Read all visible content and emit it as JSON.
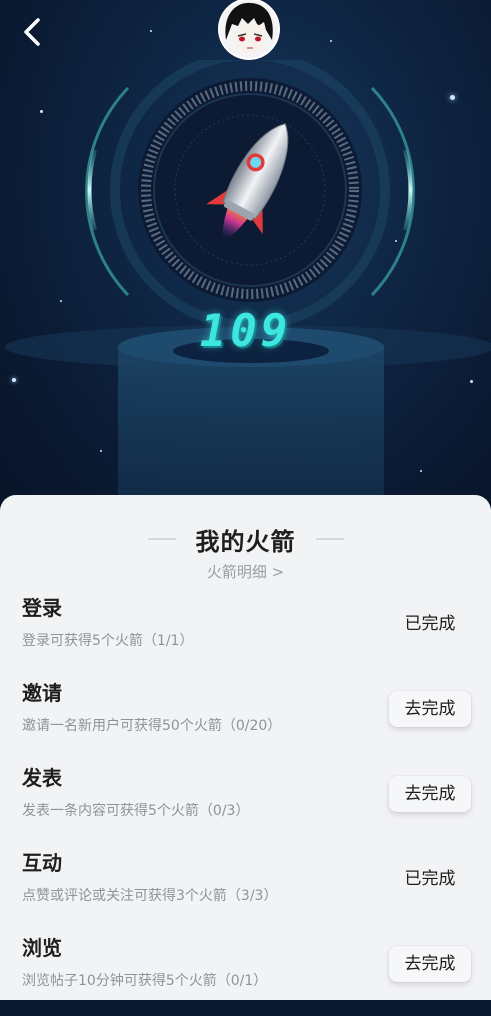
{
  "header": {
    "back_icon": "chevron-left-icon",
    "avatar_icon": "anime-avatar"
  },
  "rocket": {
    "count": "109",
    "accent_color": "#3ee6e0"
  },
  "panel": {
    "title": "我的火箭",
    "detail_link": "火箭明细 >"
  },
  "tasks": [
    {
      "name": "登录",
      "desc": "登录可获得5个火箭（1/1）",
      "action": "已完成",
      "status": "done"
    },
    {
      "name": "邀请",
      "desc": "邀请一名新用户可获得50个火箭（0/20）",
      "action": "去完成",
      "status": "todo"
    },
    {
      "name": "发表",
      "desc": "发表一条内容可获得5个火箭（0/3）",
      "action": "去完成",
      "status": "todo"
    },
    {
      "name": "互动",
      "desc": "点赞或评论或关注可获得3个火箭（3/3）",
      "action": "已完成",
      "status": "done"
    },
    {
      "name": "浏览",
      "desc": "浏览帖子10分钟可获得5个火箭（0/1）",
      "action": "去完成",
      "status": "todo"
    }
  ]
}
